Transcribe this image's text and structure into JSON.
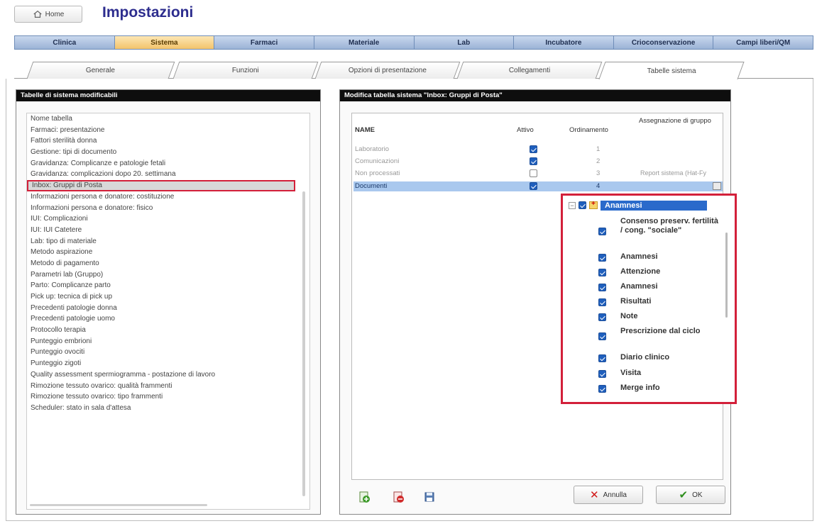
{
  "header": {
    "home_label": "Home",
    "title": "Impostazioni"
  },
  "main_tabs": [
    {
      "label": "Clinica",
      "active": false
    },
    {
      "label": "Sistema",
      "active": true
    },
    {
      "label": "Farmaci",
      "active": false
    },
    {
      "label": "Materiale",
      "active": false
    },
    {
      "label": "Lab",
      "active": false
    },
    {
      "label": "Incubatore",
      "active": false
    },
    {
      "label": "Crioconservazione",
      "active": false
    },
    {
      "label": "Campi liberi/QM",
      "active": false
    }
  ],
  "sub_tabs": [
    {
      "label": "Generale",
      "active": false
    },
    {
      "label": "Funzioni",
      "active": false
    },
    {
      "label": "Opzioni di presentazione",
      "active": false
    },
    {
      "label": "Collegamenti",
      "active": false
    },
    {
      "label": "Tabelle sistema",
      "active": true
    }
  ],
  "left_panel": {
    "title": "Tabelle di sistema modificabili",
    "items": [
      "Nome tabella",
      "Farmaci: presentazione",
      "Fattori sterilità donna",
      "Gestione: tipi di documento",
      "Gravidanza: Complicanze e patologie fetali",
      "Gravidanza: complicazioni dopo 20. settimana",
      "Inbox: Gruppi di Posta",
      "Informazioni persona e donatore: costituzione",
      "Informazioni persona e donatore: fisico",
      "IUI: Complicazioni",
      "IUI: IUI Catetere",
      "Lab: tipo di materiale",
      "Metodo aspirazione",
      "Metodo di pagamento",
      "Parametri lab (Gruppo)",
      "Parto: Complicanze parto",
      "Pick up: tecnica di pick up",
      "Precedenti patologie donna",
      "Precedenti patologie uomo",
      "Protocollo terapia",
      "Punteggio embrioni",
      "Punteggio ovociti",
      "Punteggio zigoti",
      "Quality assessment spermiogramma - postazione di lavoro",
      "Rimozione tessuto ovarico: qualità frammenti",
      "Rimozione tessuto ovarico: tipo frammenti",
      "Scheduler: stato in sala d'attesa"
    ],
    "selected_index": 6
  },
  "right_panel": {
    "title": "Modifica tabella sistema \"Inbox: Gruppi di Posta\"",
    "columns": {
      "name": "NAME",
      "active": "Attivo",
      "order": "Ordinamento",
      "group": "Assegnazione di gruppo"
    },
    "rows": [
      {
        "name": "Laboratorio",
        "active": true,
        "order": "1",
        "group": ""
      },
      {
        "name": "Comunicazioni",
        "active": true,
        "order": "2",
        "group": ""
      },
      {
        "name": "Non processati",
        "active": false,
        "order": "3",
        "group": "Report sistema (Hat-Fy"
      },
      {
        "name": "Documenti",
        "active": true,
        "order": "4",
        "group": ""
      }
    ],
    "popup": {
      "root_label": "Anamnesi",
      "items": [
        {
          "label": "Consenso preserv. fertilità / cong. \"sociale\"",
          "checked": true
        },
        {
          "label": "Anamnesi",
          "checked": true
        },
        {
          "label": "Attenzione",
          "checked": true
        },
        {
          "label": "Anamnesi",
          "checked": true
        },
        {
          "label": "Risultati",
          "checked": true
        },
        {
          "label": "Note",
          "checked": true
        },
        {
          "label": "Prescrizione dal ciclo",
          "checked": true
        },
        {
          "label": "Diario clinico",
          "checked": true
        },
        {
          "label": "Visita",
          "checked": true
        },
        {
          "label": "Merge info",
          "checked": true
        }
      ]
    },
    "buttons": {
      "cancel": "Annulla",
      "ok": "OK"
    }
  }
}
